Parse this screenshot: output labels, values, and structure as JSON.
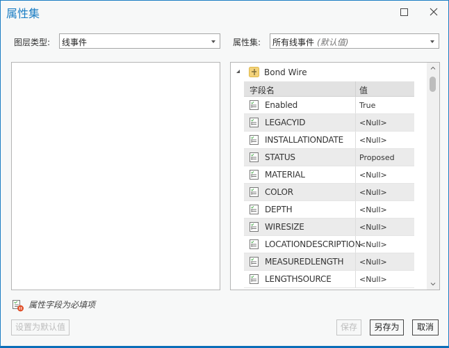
{
  "window": {
    "title": "属性集",
    "maximize_icon": "maximize-icon",
    "close_icon": "close-icon"
  },
  "filters": {
    "layer_type_label": "图层类型:",
    "layer_type_value": "线事件",
    "attribute_set_label": "属性集:",
    "attribute_set_value": "所有线事件",
    "attribute_set_hint": "(默认值)"
  },
  "tree": {
    "layer_name": "Bond Wire",
    "layer_icon": "line-event-layer-icon",
    "columns": {
      "field": "字段名",
      "value": "值"
    },
    "rows": [
      {
        "field": "Enabled",
        "value": "True"
      },
      {
        "field": "LEGACYID",
        "value": "<Null>"
      },
      {
        "field": "INSTALLATIONDATE",
        "value": "<Null>"
      },
      {
        "field": "STATUS",
        "value": "Proposed"
      },
      {
        "field": "MATERIAL",
        "value": "<Null>"
      },
      {
        "field": "COLOR",
        "value": "<Null>"
      },
      {
        "field": "DEPTH",
        "value": "<Null>"
      },
      {
        "field": "WIRESIZE",
        "value": "<Null>"
      },
      {
        "field": "LOCATIONDESCRIPTION",
        "value": "<Null>"
      },
      {
        "field": "MEASUREDLENGTH",
        "value": "<Null>"
      },
      {
        "field": "LENGTHSOURCE",
        "value": "<Null>"
      }
    ]
  },
  "legend": {
    "icon": "required-field-icon",
    "text": "属性字段为必填项"
  },
  "buttons": {
    "set_default": "设置为默认值",
    "save": "保存",
    "save_as": "另存为",
    "cancel": "取消"
  },
  "colors": {
    "accent": "#1c7ec4",
    "required_badge": "#e0502a"
  }
}
